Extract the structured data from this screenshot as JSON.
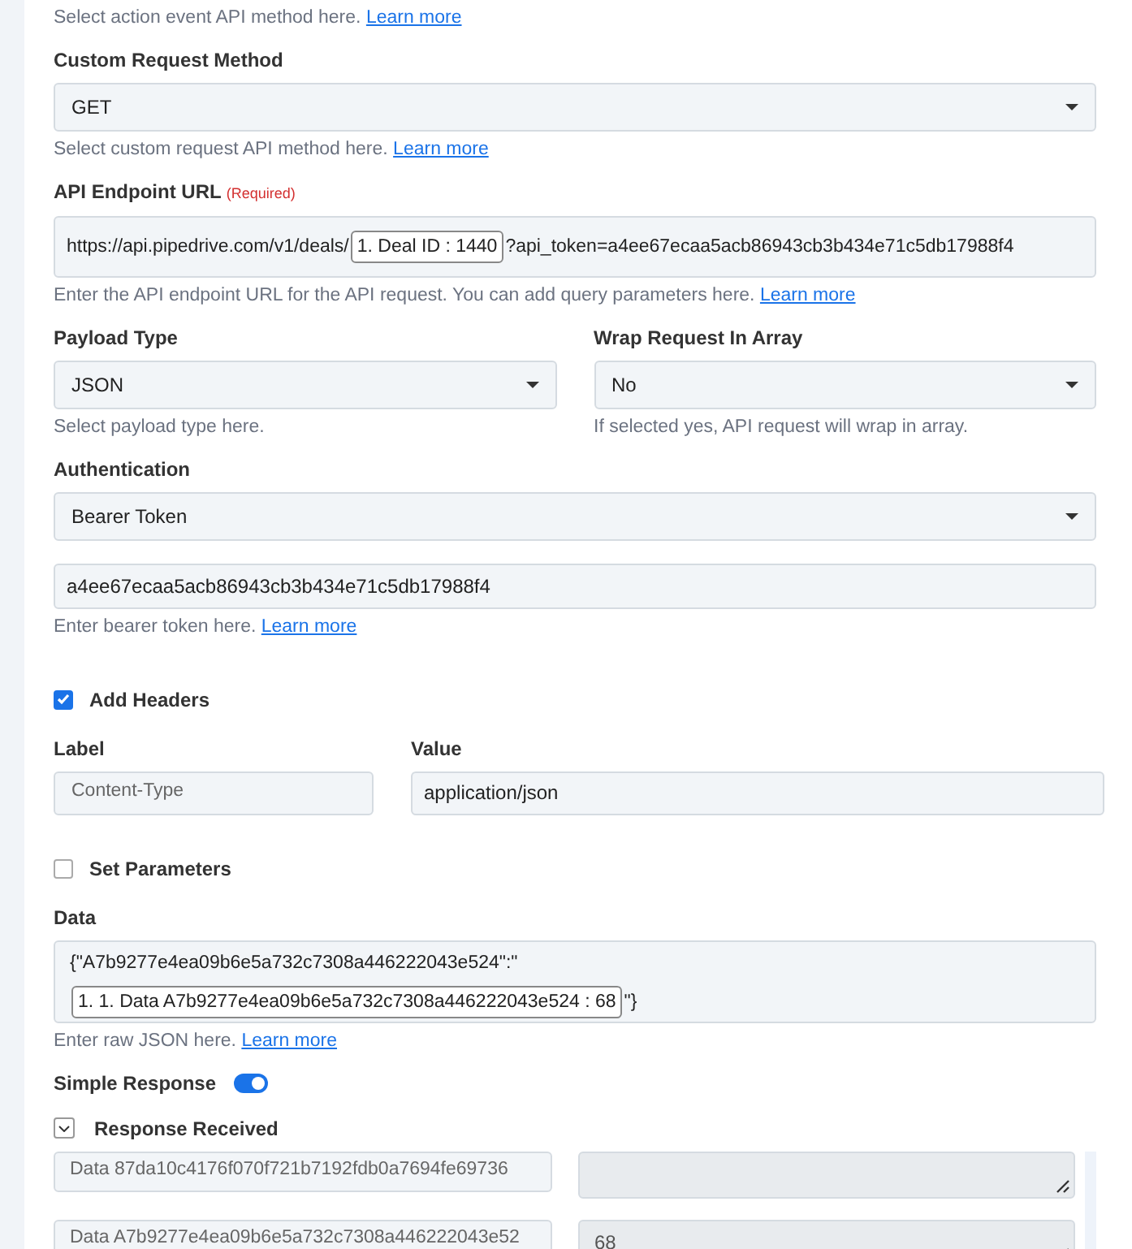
{
  "top_hint": {
    "text": "Select action event API method here.",
    "link": "Learn more"
  },
  "custom_method": {
    "label": "Custom Request Method",
    "value": "GET",
    "hint": "Select custom request API method here.",
    "link": "Learn more"
  },
  "endpoint": {
    "label": "API Endpoint URL",
    "required": "(Required)",
    "segments": [
      {
        "kind": "text",
        "text": "https://api.pipedrive.com/v1/deals/"
      },
      {
        "kind": "token",
        "text": "1. Deal ID : 1440"
      },
      {
        "kind": "text",
        "text": "?api_token=a4ee67ecaa5acb86943cb3b434e71c5db17988f4"
      }
    ],
    "hint": "Enter the API endpoint URL for the API request. You can add query parameters here.",
    "link": "Learn more"
  },
  "payload_type": {
    "label": "Payload Type",
    "value": "JSON",
    "hint": "Select payload type here."
  },
  "wrap_request": {
    "label": "Wrap Request In Array",
    "value": "No",
    "hint": "If selected yes, API request will wrap in array."
  },
  "authentication": {
    "label": "Authentication",
    "value": "Bearer Token",
    "token_value": "a4ee67ecaa5acb86943cb3b434e71c5db17988f4",
    "hint": "Enter bearer token here.",
    "link": "Learn more"
  },
  "add_headers": {
    "label": "Add Headers",
    "checked": true,
    "label_heading": "Label",
    "value_heading": "Value",
    "header_label": "Content-Type",
    "header_value": "application/json"
  },
  "set_parameters": {
    "label": "Set Parameters",
    "checked": false
  },
  "data": {
    "label": "Data",
    "segments": [
      {
        "kind": "text",
        "text": "{\"A7b9277e4ea09b6e5a732c7308a446222043e524\":\""
      },
      {
        "kind": "token",
        "text": "1. 1. Data A7b9277e4ea09b6e5a732c7308a446222043e524 : 68"
      },
      {
        "kind": "text",
        "text": "\"}"
      }
    ],
    "hint": "Enter raw JSON here.",
    "link": "Learn more"
  },
  "simple_response": {
    "label": "Simple Response",
    "on": true
  },
  "response_received": {
    "label": "Response Received",
    "expanded": true,
    "rows": [
      {
        "label": "Data 87da10c4176f070f721b7192fdb0a7694fe69736"
      },
      {
        "label": "Data A7b9277e4ea09b6e5a732c7308a446222043e52",
        "value": "68"
      }
    ]
  }
}
